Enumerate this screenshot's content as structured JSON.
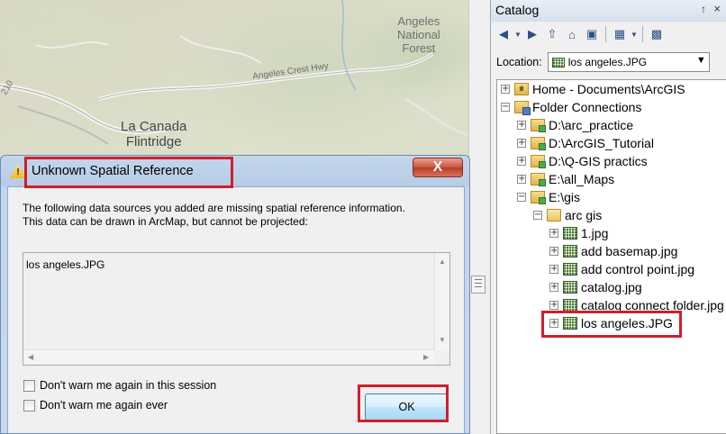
{
  "map": {
    "labels": {
      "forest": "Angeles\nNational\nForest",
      "road": "Angeles Crest Hwy",
      "city": "La Canada\nFlintridge",
      "shield": "210"
    }
  },
  "catalog": {
    "title": "Catalog",
    "pin_glyph": "↑",
    "close_glyph": "×",
    "location_label": "Location:",
    "location_value": "los angeles.JPG",
    "tree": [
      {
        "label": "Home - Documents\\ArcGIS",
        "level": 0,
        "expander": "+",
        "icon": "home-folder-icon"
      },
      {
        "label": "Folder Connections",
        "level": 0,
        "expander": "−",
        "icon": "folder-connections-icon"
      },
      {
        "label": "D:\\arc_practice",
        "level": 1,
        "expander": "+",
        "icon": "folder-connection-icon"
      },
      {
        "label": "D:\\ArcGIS_Tutorial",
        "level": 1,
        "expander": "+",
        "icon": "folder-connection-icon"
      },
      {
        "label": "D:\\Q-GIS practics",
        "level": 1,
        "expander": "+",
        "icon": "folder-connection-icon"
      },
      {
        "label": "E:\\all_Maps",
        "level": 1,
        "expander": "+",
        "icon": "folder-connection-icon"
      },
      {
        "label": "E:\\gis",
        "level": 1,
        "expander": "−",
        "icon": "folder-connection-open-icon"
      },
      {
        "label": "arc gis",
        "level": 2,
        "expander": "−",
        "icon": "folder-open-icon"
      },
      {
        "label": "1.jpg",
        "level": 3,
        "expander": "+",
        "icon": "raster-icon"
      },
      {
        "label": "add basemap.jpg",
        "level": 3,
        "expander": "+",
        "icon": "raster-icon"
      },
      {
        "label": "add control point.jpg",
        "level": 3,
        "expander": "+",
        "icon": "raster-icon"
      },
      {
        "label": "catalog.jpg",
        "level": 3,
        "expander": "+",
        "icon": "raster-icon"
      },
      {
        "label": "catalog connect folder.jpg",
        "level": 3,
        "expander": "+",
        "icon": "raster-icon"
      },
      {
        "label": "los angeles.JPG",
        "level": 3,
        "expander": "+",
        "icon": "raster-icon",
        "highlighted": true
      }
    ]
  },
  "dialog": {
    "title": "Unknown Spatial Reference",
    "close_glyph": "X",
    "warning_glyph": "!",
    "message_line1": "The following data sources you added are missing spatial reference information.",
    "message_line2": "This data can be drawn in ArcMap, but cannot be projected:",
    "list_items": [
      "los angeles.JPG"
    ],
    "checkbox_session": "Don't warn me again in this session",
    "checkbox_ever": "Don't warn me again ever",
    "ok_label": "OK"
  },
  "colors": {
    "highlight_box": "#d11e2b",
    "title_bar": "#c4d6ee",
    "close_button": "#c9523c"
  }
}
